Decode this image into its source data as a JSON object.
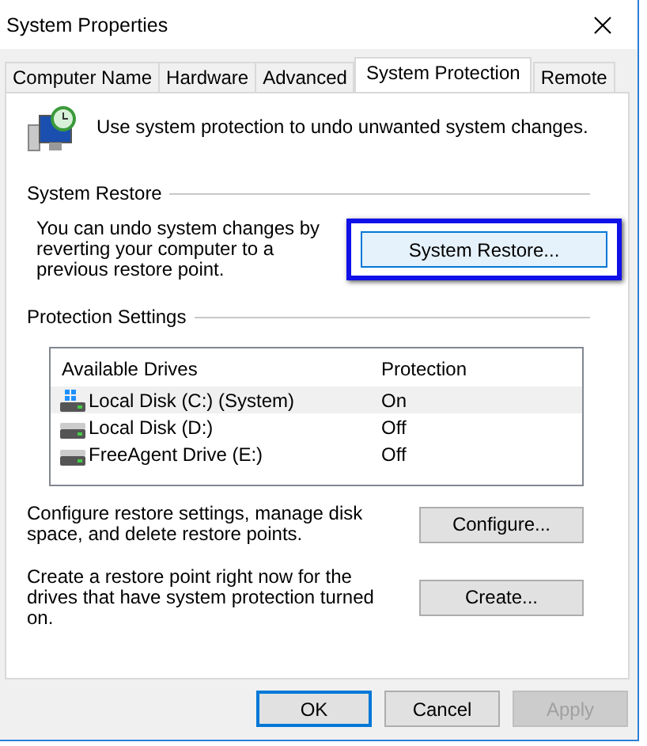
{
  "window": {
    "title": "System Properties"
  },
  "tabs": [
    {
      "label": "Computer Name",
      "selected": false
    },
    {
      "label": "Hardware",
      "selected": false
    },
    {
      "label": "Advanced",
      "selected": false
    },
    {
      "label": "System Protection",
      "selected": true
    },
    {
      "label": "Remote",
      "selected": false
    }
  ],
  "intro": "Use system protection to undo unwanted system changes.",
  "system_restore": {
    "heading": "System Restore",
    "description": "You can undo system changes by reverting your computer to a previous restore point.",
    "button": "System Restore..."
  },
  "protection_settings": {
    "heading": "Protection Settings",
    "columns": [
      "Available Drives",
      "Protection"
    ],
    "drives": [
      {
        "name": "Local Disk (C:) (System)",
        "protection": "On",
        "kind": "system",
        "selected": true
      },
      {
        "name": "Local Disk (D:)",
        "protection": "Off",
        "kind": "disk",
        "selected": false
      },
      {
        "name": "FreeAgent Drive (E:)",
        "protection": "Off",
        "kind": "disk",
        "selected": false
      }
    ],
    "actions": [
      {
        "text": "Configure restore settings, manage disk space, and delete restore points.",
        "button": "Configure..."
      },
      {
        "text": "Create a restore point right now for the drives that have system protection turned on.",
        "button": "Create..."
      }
    ]
  },
  "buttons": [
    {
      "label": "OK",
      "default": true,
      "disabled": false
    },
    {
      "label": "Cancel",
      "default": false,
      "disabled": false
    },
    {
      "label": "Apply",
      "default": false,
      "disabled": true
    }
  ]
}
